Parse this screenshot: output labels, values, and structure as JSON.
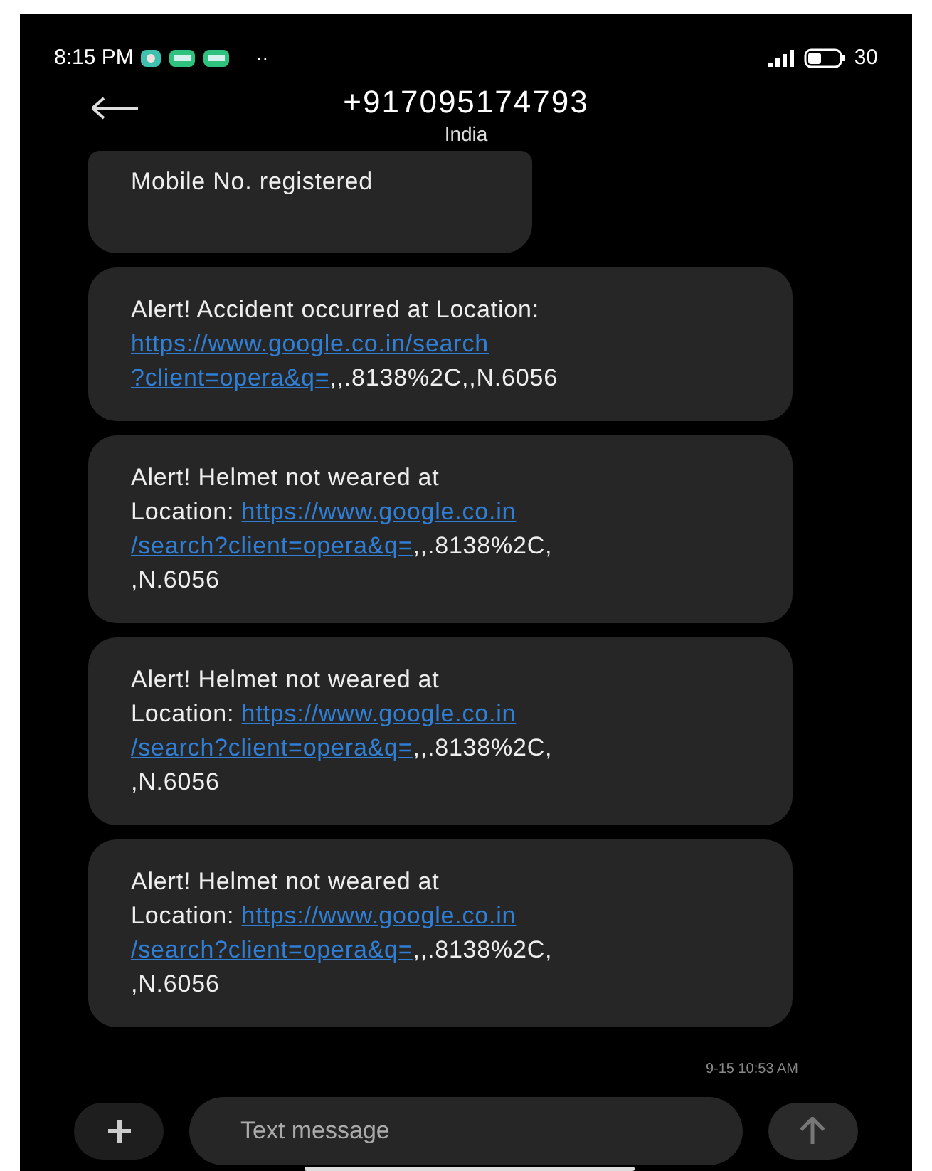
{
  "status_bar": {
    "time": "8:15 PM",
    "more": "··",
    "battery": "30"
  },
  "header": {
    "title": "+917095174793",
    "subtitle": "India"
  },
  "messages": [
    {
      "lines": [
        [
          {
            "kind": "text",
            "text": "Mobile No. registered"
          }
        ]
      ]
    },
    {
      "lines": [
        [
          {
            "kind": "text",
            "text": "Alert! Accident occurred at Location:"
          }
        ],
        [
          {
            "kind": "link",
            "text": "https://www.google.co.in/search"
          }
        ],
        [
          {
            "kind": "link",
            "text": "?client=opera&q="
          },
          {
            "kind": "text",
            "text": ",,.8138%2C,,N.6056"
          }
        ]
      ]
    },
    {
      "lines": [
        [
          {
            "kind": "text",
            "text": "Alert! Helmet not weared at"
          }
        ],
        [
          {
            "kind": "text",
            "text": "Location: "
          },
          {
            "kind": "link",
            "text": "https://www.google.co.in"
          }
        ],
        [
          {
            "kind": "link",
            "text": "/search?client=opera&q="
          },
          {
            "kind": "text",
            "text": ",,.8138%2C,"
          }
        ],
        [
          {
            "kind": "text",
            "text": ",N.6056"
          }
        ]
      ]
    },
    {
      "lines": [
        [
          {
            "kind": "text",
            "text": "Alert! Helmet not weared at"
          }
        ],
        [
          {
            "kind": "text",
            "text": "Location: "
          },
          {
            "kind": "link",
            "text": "https://www.google.co.in"
          }
        ],
        [
          {
            "kind": "link",
            "text": "/search?client=opera&q="
          },
          {
            "kind": "text",
            "text": ",,.8138%2C,"
          }
        ],
        [
          {
            "kind": "text",
            "text": ",N.6056"
          }
        ]
      ]
    },
    {
      "lines": [
        [
          {
            "kind": "text",
            "text": "Alert! Helmet not weared at"
          }
        ],
        [
          {
            "kind": "text",
            "text": "Location: "
          },
          {
            "kind": "link",
            "text": "https://www.google.co.in"
          }
        ],
        [
          {
            "kind": "link",
            "text": "/search?client=opera&q="
          },
          {
            "kind": "text",
            "text": ",,.8138%2C,"
          }
        ],
        [
          {
            "kind": "text",
            "text": ",N.6056"
          }
        ]
      ]
    }
  ],
  "timestamp": "9-15 10:53 AM",
  "composer": {
    "placeholder": "Text message"
  }
}
